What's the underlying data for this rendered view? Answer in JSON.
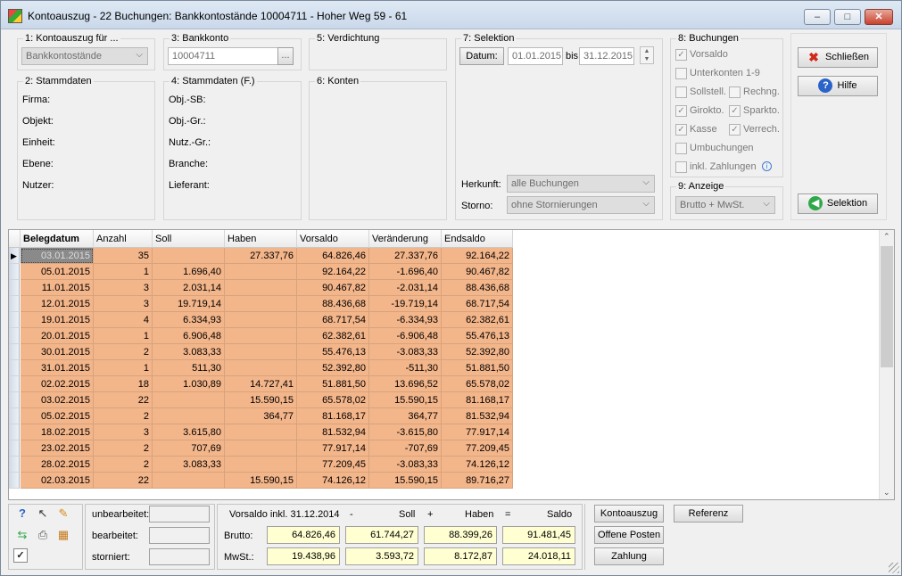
{
  "window": {
    "title": "Kontoauszug - 22 Buchungen:  Bankkontostände 10004711 - Hoher Weg 59 - 61",
    "min": "–",
    "max": "□",
    "close": "✕"
  },
  "groups": {
    "kontoauszug": {
      "label": "1: Kontoauszug für ...",
      "value": "Bankkontostände"
    },
    "bankkonto": {
      "label": "3: Bankkonto",
      "value": "10004711",
      "btn": "..."
    },
    "verdichtung": {
      "label": "5: Verdichtung"
    },
    "stammdaten": {
      "label": "2: Stammdaten",
      "fields": [
        "Firma:",
        "Objekt:",
        "Einheit:",
        "Ebene:",
        "Nutzer:"
      ]
    },
    "stammdaten_f": {
      "label": "4: Stammdaten (F.)",
      "fields": [
        "Obj.-SB:",
        "Obj.-Gr.:",
        "Nutz.-Gr.:",
        "Branche:",
        "Lieferant:"
      ]
    },
    "konten": {
      "label": "6: Konten"
    },
    "selektion": {
      "label": "7: Selektion",
      "datum_label": "Datum:",
      "von": "01.01.2015",
      "bis_label": "bis",
      "bis": "31.12.2015",
      "herkunft_label": "Herkunft:",
      "herkunft": "alle Buchungen",
      "storno_label": "Storno:",
      "storno": "ohne Stornierungen"
    },
    "buchungen": {
      "label": "8: Buchungen",
      "vorsaldo": "Vorsaldo",
      "unterkonten": "Unterkonten 1-9",
      "sollstell": "Sollstell.",
      "rechng": "Rechng.",
      "girokto": "Girokto.",
      "sparkto": "Sparkto.",
      "kasse": "Kasse",
      "verrech": "Verrech.",
      "umbuchungen": "Umbuchungen",
      "inkl_zahlungen": "inkl. Zahlungen"
    },
    "anzeige": {
      "label": "9: Anzeige",
      "value": "Brutto + MwSt."
    }
  },
  "buttons": {
    "schliessen": "Schließen",
    "hilfe": "Hilfe",
    "selektion": "Selektion"
  },
  "table": {
    "headers": [
      "Belegdatum",
      "Anzahl",
      "Soll",
      "Haben",
      "Vorsaldo",
      "Veränderung",
      "Endsaldo"
    ],
    "rows": [
      [
        "03.01.2015",
        "35",
        "",
        "27.337,76",
        "64.826,46",
        "27.337,76",
        "92.164,22"
      ],
      [
        "05.01.2015",
        "1",
        "1.696,40",
        "",
        "92.164,22",
        "-1.696,40",
        "90.467,82"
      ],
      [
        "11.01.2015",
        "3",
        "2.031,14",
        "",
        "90.467,82",
        "-2.031,14",
        "88.436,68"
      ],
      [
        "12.01.2015",
        "3",
        "19.719,14",
        "",
        "88.436,68",
        "-19.719,14",
        "68.717,54"
      ],
      [
        "19.01.2015",
        "4",
        "6.334,93",
        "",
        "68.717,54",
        "-6.334,93",
        "62.382,61"
      ],
      [
        "20.01.2015",
        "1",
        "6.906,48",
        "",
        "62.382,61",
        "-6.906,48",
        "55.476,13"
      ],
      [
        "30.01.2015",
        "2",
        "3.083,33",
        "",
        "55.476,13",
        "-3.083,33",
        "52.392,80"
      ],
      [
        "31.01.2015",
        "1",
        "511,30",
        "",
        "52.392,80",
        "-511,30",
        "51.881,50"
      ],
      [
        "02.02.2015",
        "18",
        "1.030,89",
        "14.727,41",
        "51.881,50",
        "13.696,52",
        "65.578,02"
      ],
      [
        "03.02.2015",
        "22",
        "",
        "15.590,15",
        "65.578,02",
        "15.590,15",
        "81.168,17"
      ],
      [
        "05.02.2015",
        "2",
        "",
        "364,77",
        "81.168,17",
        "364,77",
        "81.532,94"
      ],
      [
        "18.02.2015",
        "3",
        "3.615,80",
        "",
        "81.532,94",
        "-3.615,80",
        "77.917,14"
      ],
      [
        "23.02.2015",
        "2",
        "707,69",
        "",
        "77.917,14",
        "-707,69",
        "77.209,45"
      ],
      [
        "28.02.2015",
        "2",
        "3.083,33",
        "",
        "77.209,45",
        "-3.083,33",
        "74.126,12"
      ],
      [
        "02.03.2015",
        "22",
        "",
        "15.590,15",
        "74.126,12",
        "15.590,15",
        "89.716,27"
      ]
    ]
  },
  "status": {
    "unbearbeitet": "unbearbeitet:",
    "bearbeitet": "bearbeitet:",
    "storniert": "storniert:"
  },
  "summary": {
    "title": "Vorsaldo inkl. 31.12.2014",
    "minus": "-",
    "soll": "Soll",
    "plus": "+",
    "haben": "Haben",
    "eq": "=",
    "saldo": "Saldo",
    "brutto_label": "Brutto:",
    "brutto": [
      "64.826,46",
      "61.744,27",
      "88.399,26",
      "91.481,45"
    ],
    "mwst_label": "MwSt.:",
    "mwst": [
      "19.438,96",
      "3.593,72",
      "8.172,87",
      "24.018,11"
    ]
  },
  "actions": {
    "kontoauszug": "Kontoauszug",
    "referenz": "Referenz",
    "offene_posten": "Offene Posten",
    "zahlung": "Zahlung"
  }
}
